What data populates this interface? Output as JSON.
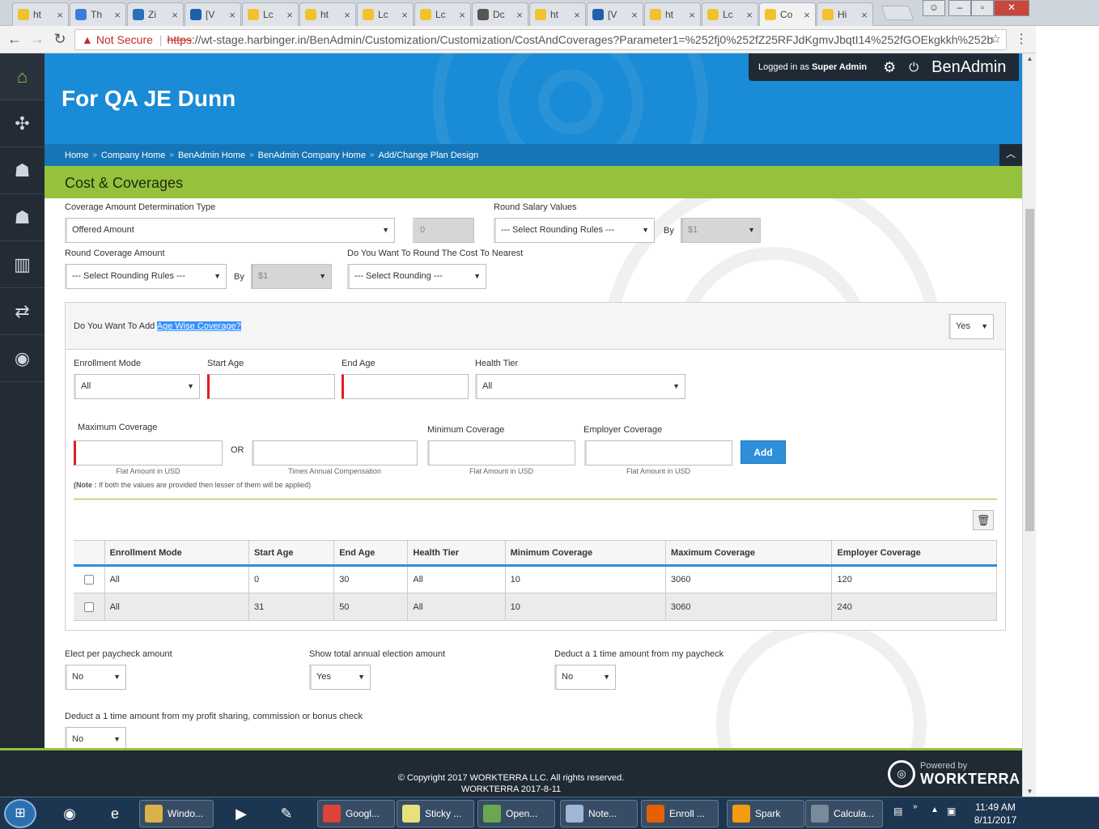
{
  "browser": {
    "tabs": [
      {
        "label": "ht",
        "color": "#f2c12e"
      },
      {
        "label": "Th",
        "color": "#3b7dd8"
      },
      {
        "label": "Zi",
        "color": "#2a6fb8"
      },
      {
        "label": "[V",
        "color": "#1f5fb0"
      },
      {
        "label": "Lc",
        "color": "#f2c12e"
      },
      {
        "label": "ht",
        "color": "#f2c12e"
      },
      {
        "label": "Lc",
        "color": "#f2c12e"
      },
      {
        "label": "Lc",
        "color": "#f2c12e"
      },
      {
        "label": "Dc",
        "color": "#555555"
      },
      {
        "label": "ht",
        "color": "#f2c12e"
      },
      {
        "label": "[V",
        "color": "#1f5fb0"
      },
      {
        "label": "ht",
        "color": "#f2c12e"
      },
      {
        "label": "Lc",
        "color": "#f2c12e"
      },
      {
        "label": "Co",
        "color": "#f2c12e",
        "active": true
      },
      {
        "label": "Hi",
        "color": "#f2c12e"
      }
    ],
    "not_secure": "Not Secure",
    "url_scheme": "https",
    "url_rest": "://wt-stage.harbinger.in/BenAdmin/Customization/Customization/CostAndCoverages?Parameter1=%252fj0%252fZ25RFJdKgmvJbqtI14%252fGOEkgkkh%252b"
  },
  "sidebar": {
    "items": [
      {
        "icon": "home-icon",
        "glyph": "⌂"
      },
      {
        "icon": "puzzle-icon",
        "glyph": "✣"
      },
      {
        "icon": "user-star-icon",
        "glyph": "☗"
      },
      {
        "icon": "user-icon",
        "glyph": "☗"
      },
      {
        "icon": "bar-chart-icon",
        "glyph": "▥"
      },
      {
        "icon": "transfer-icon",
        "glyph": "⇄"
      },
      {
        "icon": "chat-icon",
        "glyph": "◉"
      }
    ]
  },
  "header": {
    "title": "For QA JE Dunn",
    "logged_in_prefix": "Logged in as",
    "user": "Super Admin",
    "brand": "BenAdmin",
    "breadcrumbs": [
      "Home",
      "Company Home",
      "BenAdmin Home",
      "BenAdmin Company Home",
      "Add/Change Plan Design"
    ]
  },
  "page": {
    "title": "Cost & Coverages"
  },
  "form": {
    "coverage_type_label": "Coverage Amount Determination Type",
    "coverage_type_value": "Offered Amount",
    "coverage_amount_value": "0",
    "round_salary_label": "Round Salary Values",
    "round_salary_value": "--- Select Rounding Rules ---",
    "by_label": "By",
    "round_salary_by_value": "$1",
    "round_coverage_label": "Round Coverage Amount",
    "round_coverage_value": "--- Select Rounding Rules ---",
    "round_coverage_by_value": "$1",
    "round_cost_label": "Do You Want To Round The Cost To Nearest",
    "round_cost_value": "--- Select Rounding ---"
  },
  "age_wise": {
    "question_prefix": "Do You Want To Add ",
    "question_highlight": "Age Wise Coverage?",
    "answer": "Yes",
    "enrollment_mode_label": "Enrollment Mode",
    "enrollment_mode_value": "All",
    "start_age_label": "Start Age",
    "end_age_label": "End Age",
    "health_tier_label": "Health Tier",
    "health_tier_value": "All",
    "max_coverage_label": "Maximum Coverage",
    "or_label": "OR",
    "min_coverage_label": "Minimum Coverage",
    "employer_coverage_label": "Employer Coverage",
    "add_button": "Add",
    "hint_flat": "Flat Amount in USD",
    "hint_times": "Times Annual Compensation",
    "hint_flat_min": "Flat Amount in USD",
    "hint_flat_emp": "Flat Amount in USD",
    "note_bold": "(Note :",
    "note_rest": " If both the values are provided then lesser of them will be applied)"
  },
  "table": {
    "columns": [
      "Enrollment Mode",
      "Start Age",
      "End Age",
      "Health Tier",
      "Minimum Coverage",
      "Maximum Coverage",
      "Employer Coverage"
    ],
    "rows": [
      [
        "All",
        "0",
        "30",
        "All",
        "10",
        "3060",
        "120"
      ],
      [
        "All",
        "31",
        "50",
        "All",
        "10",
        "3060",
        "240"
      ]
    ]
  },
  "options": {
    "elect_per_paycheck_label": "Elect per paycheck amount",
    "elect_per_paycheck_value": "No",
    "show_total_label": "Show total annual election amount",
    "show_total_value": "Yes",
    "deduct_paycheck_label": "Deduct a 1 time amount from my paycheck",
    "deduct_paycheck_value": "No",
    "deduct_bonus_label": "Deduct a 1 time amount from my profit sharing, commission or bonus check",
    "deduct_bonus_value": "No"
  },
  "footer": {
    "copyright": "© Copyright 2017 WORKTERRA LLC. All rights reserved.",
    "build": "WORKTERRA 2017-8-11",
    "powered_by": "Powered by",
    "powered_brand": "WORKTERRA"
  },
  "taskbar": {
    "apps": [
      {
        "label": "Windo...",
        "color": "#d9b24a"
      },
      {
        "label": "Googl...",
        "color": "#db4437"
      },
      {
        "label": "Sticky ...",
        "color": "#e8e07a"
      },
      {
        "label": "Open...",
        "color": "#6aa84f"
      },
      {
        "label": "Note...",
        "color": "#9fb8d6"
      },
      {
        "label": "Enroll ...",
        "color": "#e66000"
      },
      {
        "label": "Spark",
        "color": "#f39c12"
      },
      {
        "label": "Calcula...",
        "color": "#7a8a9a"
      }
    ],
    "time": "11:49 AM",
    "date": "8/11/2017"
  },
  "colors": {
    "header_blue": "#1a8bd6",
    "accent_green": "#95c13d",
    "sidebar_dark": "#232c35",
    "button_blue": "#2d8fd9",
    "required_red": "#e31b23"
  }
}
